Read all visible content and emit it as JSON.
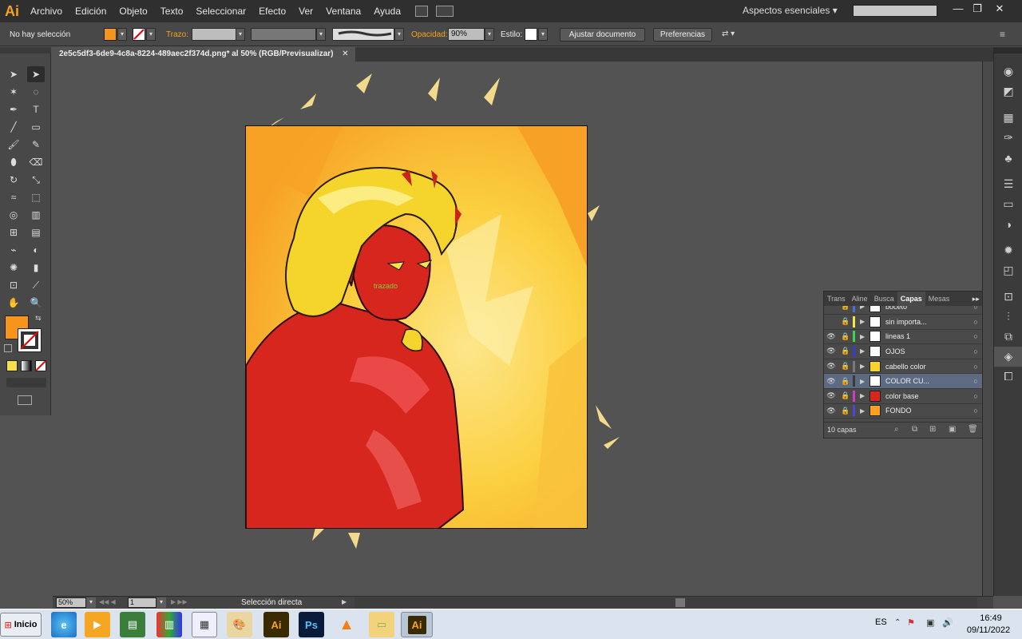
{
  "app": {
    "logo": "Ai",
    "menu": [
      "Archivo",
      "Edición",
      "Objeto",
      "Texto",
      "Seleccionar",
      "Efecto",
      "Ver",
      "Ventana",
      "Ayuda"
    ],
    "workspace": "Aspectos esenciales",
    "window_buttons": [
      "—",
      "❐",
      "✕"
    ]
  },
  "control": {
    "selection": "No hay selección",
    "stroke_label": "Trazo:",
    "opacity_label": "Opacidad:",
    "opacity_value": "90%",
    "style_label": "Estilo:",
    "adjust_button": "Ajustar documento",
    "prefs_button": "Preferencias",
    "fill_color": "#f7941d"
  },
  "document": {
    "tab_title": "2e5c5df3-6de9-4c8a-8224-489aec2f374d.png* al 50% (RGB/Previsualizar)",
    "close_glyph": "✕",
    "smart_guide": "trazado"
  },
  "layers": {
    "tabs": [
      "Trans",
      "Aline",
      "Busca",
      "Capas",
      "Mesas"
    ],
    "active_tab": "Capas",
    "rows": [
      {
        "name": "boceto",
        "color": "#4a6fd8",
        "eye": false
      },
      {
        "name": "sin importa...",
        "color": "#f2e84a",
        "eye": false
      },
      {
        "name": "lineas 1",
        "color": "#3bd64a",
        "eye": true
      },
      {
        "name": "OJOS",
        "color": "#3a3ad0",
        "eye": true
      },
      {
        "name": "cabello color",
        "color": "#7a7a7a",
        "eye": true
      },
      {
        "name": "COLOR CU...",
        "color": "#3a3a3a",
        "eye": true,
        "selected": true
      },
      {
        "name": "color base",
        "color": "#d03ac0",
        "eye": true
      },
      {
        "name": "FONDO",
        "color": "#4a4ad0",
        "eye": true
      }
    ],
    "count": "10 capas"
  },
  "status": {
    "zoom": "50%",
    "page": "1",
    "tool": "Selección directa"
  },
  "taskbar": {
    "start": "Inicio",
    "lang": "ES",
    "time": "16:49",
    "date": "09/11/2022",
    "apps": [
      "ie-icon",
      "media-player-icon",
      "monitor-icon",
      "office-icon",
      "calendar-icon",
      "paint-icon",
      "illustrator-icon",
      "photoshop-icon",
      "vlc-icon",
      "folder-icon",
      "illustrator-active-icon"
    ]
  }
}
